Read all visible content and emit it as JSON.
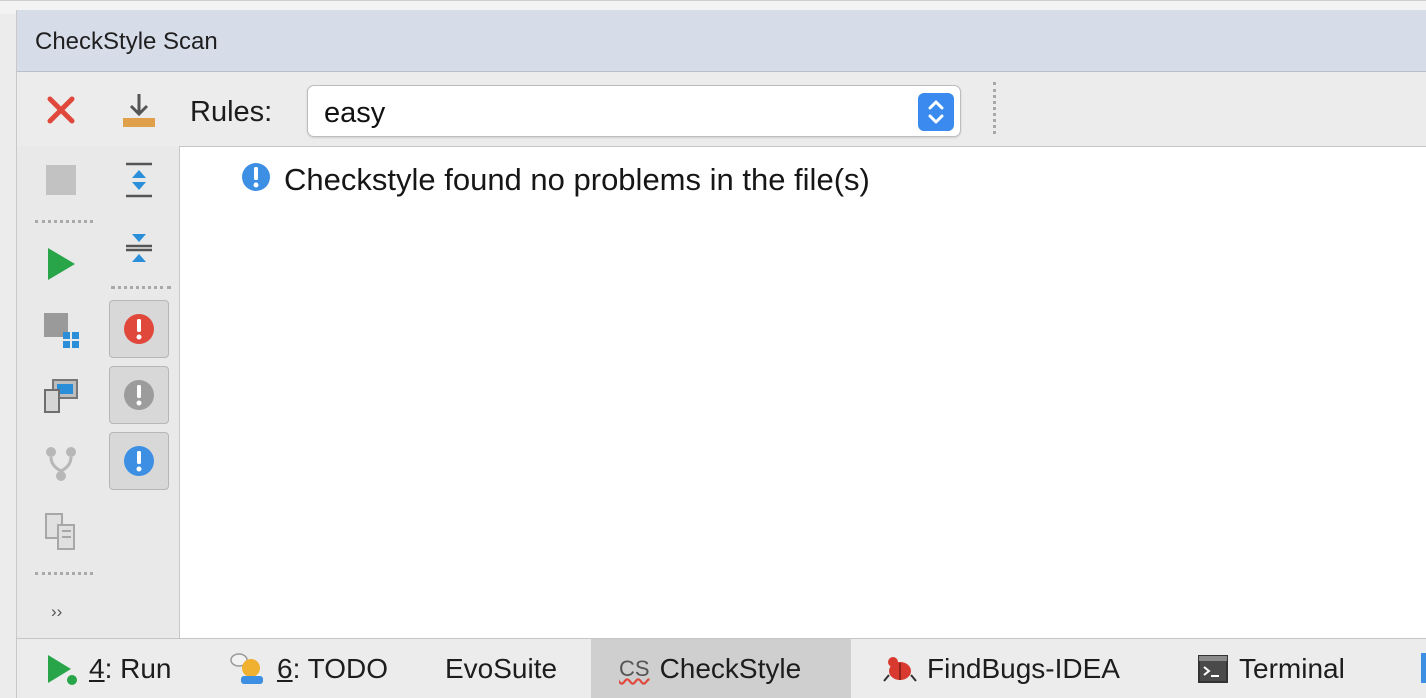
{
  "window": {
    "title": "CheckStyle Scan"
  },
  "toolbar": {
    "rules_label": "Rules:",
    "rules_value": "easy"
  },
  "result": {
    "message": "Checkstyle found no problems in the file(s)"
  },
  "left_toolbar": {
    "more_label": "››"
  },
  "statusbar": {
    "tabs": [
      {
        "num": "4",
        "label": ": Run"
      },
      {
        "num": "6",
        "label": ": TODO"
      },
      {
        "label": "EvoSuite"
      },
      {
        "prefix": "CS",
        "label": "CheckStyle"
      },
      {
        "label": "FindBugs-IDEA"
      },
      {
        "label": "Terminal"
      }
    ]
  },
  "colors": {
    "accent": "#3b8af0",
    "error": "#e0483c",
    "run": "#27a548",
    "info": "#3d8fe3",
    "title_bg": "#d6dce8"
  },
  "icons": [
    "close-icon",
    "export-icon",
    "stop-icon",
    "expand-all-icon",
    "collapse-all-icon",
    "run-icon",
    "error-filter-icon",
    "module-scan-icon",
    "warning-filter-icon",
    "project-scan-icon",
    "info-filter-icon",
    "vcs-scan-icon",
    "compare-icon",
    "info-icon",
    "findbugs-icon",
    "terminal-icon"
  ]
}
